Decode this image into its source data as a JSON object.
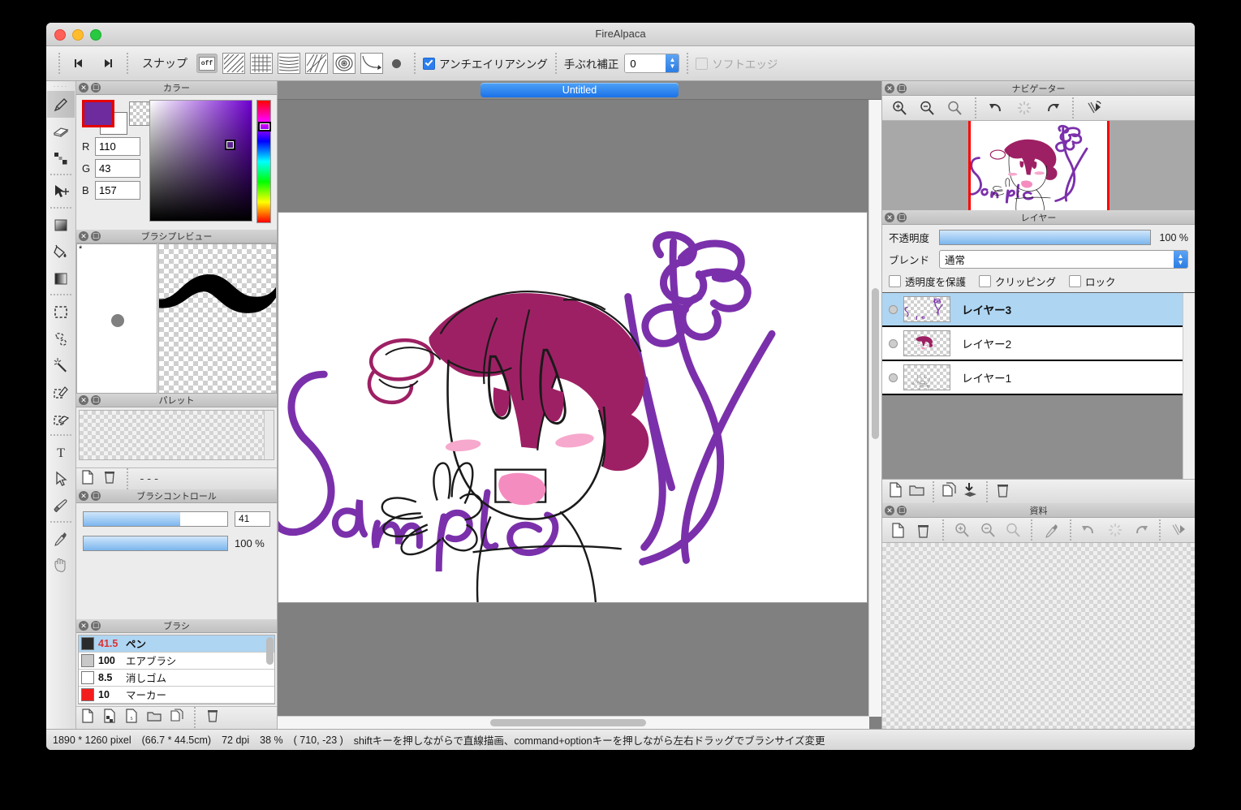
{
  "window": {
    "title": "FireAlpaca"
  },
  "toolbar": {
    "nav_prev_icon": "step-backward-icon",
    "nav_next_icon": "step-forward-icon",
    "snap_label": "スナップ",
    "snap_buttons": [
      {
        "name": "snap-off",
        "label": "off",
        "selected": true
      },
      {
        "name": "snap-parallel",
        "label": "",
        "selected": false
      },
      {
        "name": "snap-grid",
        "label": "",
        "selected": false
      },
      {
        "name": "snap-perspective",
        "label": "",
        "selected": false
      },
      {
        "name": "snap-vanishing",
        "label": "",
        "selected": false
      },
      {
        "name": "snap-radial",
        "label": "",
        "selected": false
      },
      {
        "name": "snap-curve",
        "label": "",
        "selected": false
      },
      {
        "name": "snap-point",
        "label": "",
        "selected": false
      }
    ],
    "antialias_label": "アンチエイリアシング",
    "antialias_checked": true,
    "stabilizer_label": "手ぶれ補正",
    "stabilizer_value": "0",
    "softedge_label": "ソフトエッジ",
    "softedge_checked": false
  },
  "tools": [
    {
      "name": "pen-tool",
      "icon": "pencil-icon",
      "selected": true
    },
    {
      "name": "eraser-tool",
      "icon": "eraser-icon",
      "selected": false
    },
    {
      "name": "blur-tool",
      "icon": "dots-icon",
      "selected": false
    },
    {
      "name": "move-tool",
      "icon": "move-arrow-icon",
      "selected": false
    },
    {
      "name": "bucket-tool",
      "icon": "square-gradient-icon",
      "selected": false
    },
    {
      "name": "fill-tool",
      "icon": "paint-bucket-icon",
      "selected": false
    },
    {
      "name": "gradient-tool",
      "icon": "gradient-icon",
      "selected": false
    },
    {
      "name": "select-rect-tool",
      "icon": "marquee-icon",
      "selected": false
    },
    {
      "name": "lasso-tool",
      "icon": "lasso-icon",
      "selected": false
    },
    {
      "name": "magic-wand-tool",
      "icon": "magic-wand-icon",
      "selected": false
    },
    {
      "name": "select-pen-tool",
      "icon": "select-pen-icon",
      "selected": false
    },
    {
      "name": "select-eraser-tool",
      "icon": "select-eraser-icon",
      "selected": false
    },
    {
      "name": "text-tool",
      "icon": "text-icon",
      "selected": false
    },
    {
      "name": "object-tool",
      "icon": "cursor-arrow-icon",
      "selected": false
    },
    {
      "name": "brush-tool",
      "icon": "brush-icon",
      "selected": false
    },
    {
      "name": "eyedropper-tool",
      "icon": "eyedropper-icon",
      "selected": false
    },
    {
      "name": "hand-tool",
      "icon": "hand-icon",
      "selected": false
    }
  ],
  "color_panel": {
    "title": "カラー",
    "foreground": "#6e2b9d",
    "background": "#ffffff",
    "r_label": "R",
    "r_value": "110",
    "g_label": "G",
    "g_value": "43",
    "b_label": "B",
    "b_value": "157"
  },
  "brush_preview": {
    "title": "ブラシプレビュー",
    "marker": "*"
  },
  "palette": {
    "title": "パレット",
    "name_value": "---",
    "new_icon": "new-swatch-icon",
    "delete_icon": "trash-icon"
  },
  "brush_control": {
    "title": "ブラシコントロール",
    "size_value": "41",
    "size_fill_pct": 67,
    "opacity_value": "100 %",
    "opacity_fill_pct": 100
  },
  "brush_list": {
    "title": "ブラシ",
    "items": [
      {
        "chip": "#2b2b2b",
        "size": "41.5",
        "name": "ペン",
        "selected": true
      },
      {
        "chip": "#c8c8c8",
        "size": "100",
        "name": "エアブラシ",
        "selected": false
      },
      {
        "chip": "#ffffff",
        "size": "8.5",
        "name": "消しゴム",
        "selected": false
      },
      {
        "chip": "#f31d1d",
        "size": "10",
        "name": "マーカー",
        "selected": false
      }
    ],
    "toolbar_icons": [
      "new-brush-icon",
      "duplicate-brush-icon",
      "script-brush-icon",
      "folder-icon",
      "copy-brush-icon",
      "trash-icon"
    ]
  },
  "canvas": {
    "tab_label": "Untitled"
  },
  "navigator": {
    "title": "ナビゲーター",
    "icons": [
      "zoom-in-icon",
      "zoom-out-icon",
      "zoom-reset-icon",
      "rotate-left-icon",
      "rotate-reset-icon",
      "rotate-right-icon",
      "flip-horizontal-icon"
    ]
  },
  "layers": {
    "title": "レイヤー",
    "opacity_label": "不透明度",
    "opacity_value": "100 %",
    "blend_label": "ブレンド",
    "blend_value": "通常",
    "protect_alpha_label": "透明度を保護",
    "clipping_label": "クリッピング",
    "lock_label": "ロック",
    "items": [
      {
        "name": "レイヤー3",
        "selected": true,
        "visible": true
      },
      {
        "name": "レイヤー2",
        "selected": false,
        "visible": true
      },
      {
        "name": "レイヤー1",
        "selected": false,
        "visible": true
      }
    ],
    "toolbar_icons": [
      "new-layer-icon",
      "new-folder-icon",
      "duplicate-layer-icon",
      "merge-down-icon",
      "delete-layer-icon"
    ]
  },
  "materials": {
    "title": "資料",
    "icons": [
      "new-icon",
      "trash-icon",
      "zoom-in-icon",
      "zoom-out-icon",
      "zoom-reset-icon",
      "eyedropper-icon",
      "rotate-left-icon",
      "rotate-reset-icon",
      "rotate-right-icon",
      "flip-horizontal-icon"
    ]
  },
  "statusbar": {
    "dimensions": "1890 * 1260 pixel",
    "physical": "(66.7 * 44.5cm)",
    "dpi": "72 dpi",
    "zoom": "38 %",
    "coords": "( 710, -23 )",
    "hint": "shiftキーを押しながらで直線描画、command+optionキーを押しながら左右ドラッグでブラシサイズ変更"
  },
  "artwork": {
    "hair_color": "#9e2064",
    "line_color": "#1a1a1a",
    "vine_color": "#7b30ab",
    "blush_color": "#f6a8cd",
    "mouth_color": "#f58cc0"
  }
}
